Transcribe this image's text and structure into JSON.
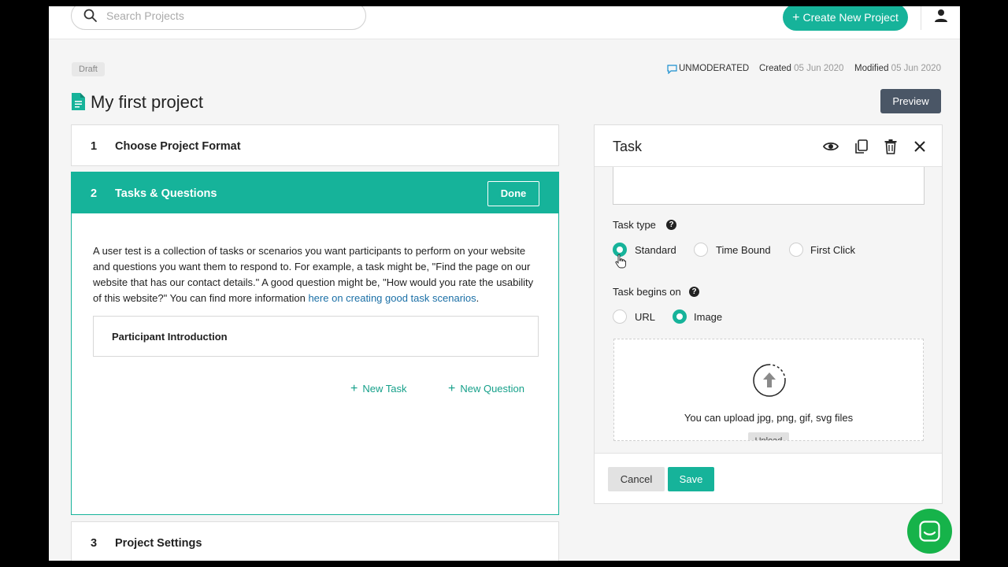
{
  "header": {
    "search_placeholder": "Search Projects",
    "create_label": "Create New Project",
    "create_plus": "+"
  },
  "project": {
    "status": "Draft",
    "moderation": "UNMODERATED",
    "created_label": "Created",
    "created_date": "05 Jun 2020",
    "modified_label": "Modified",
    "modified_date": "05 Jun 2020",
    "title": "My first project",
    "preview_label": "Preview"
  },
  "steps": [
    {
      "num": "1",
      "label": "Choose Project Format"
    },
    {
      "num": "2",
      "label": "Tasks & Questions",
      "done_label": "Done"
    },
    {
      "num": "3",
      "label": "Project Settings"
    }
  ],
  "tasks_section": {
    "description": "A user test is a collection of tasks or scenarios you want participants to perform on your website and questions you want them to respond to. For example, a task might be, \"Find the page on our website that has our contact details.\" A good question might be, \"How would you rate the usability of this website?\" You can find more information ",
    "link_text": "here on creating good task scenarios",
    "description_end": ".",
    "intro_label": "Participant Introduction",
    "new_task_label": "New Task",
    "new_question_label": "New Question",
    "plus": "+"
  },
  "task_panel": {
    "title": "Task",
    "task_type_label": "Task type",
    "task_types": [
      "Standard",
      "Time Bound",
      "First Click"
    ],
    "task_type_selected": "Standard",
    "begins_on_label": "Task begins on",
    "begins_on_options": [
      "URL",
      "Image"
    ],
    "begins_on_selected": "Image",
    "help_glyph": "?",
    "upload_text": "You can upload jpg, png, gif, svg files",
    "upload_button": "Upload",
    "cancel_label": "Cancel",
    "save_label": "Save"
  },
  "colors": {
    "accent": "#16b39a",
    "preview_button": "#4a5666",
    "link": "#1a6fa6",
    "chat_fab": "#16b34a"
  },
  "icons": [
    "search-icon",
    "user-icon",
    "chat-bubble-icon",
    "document-icon",
    "eye-icon",
    "copy-icon",
    "trash-icon",
    "close-icon",
    "help-icon",
    "upload-icon",
    "pointer-cursor-icon",
    "chat-icon"
  ]
}
